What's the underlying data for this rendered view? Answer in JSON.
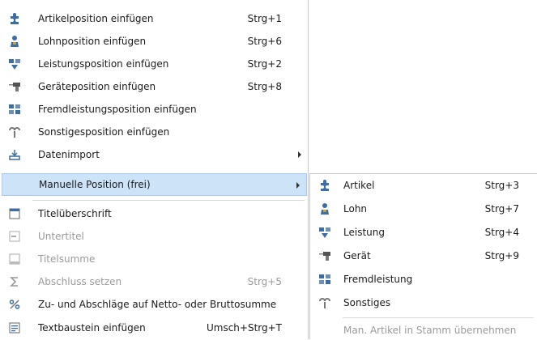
{
  "main_menu": {
    "items": [
      {
        "label": "Artikelposition einfügen",
        "shortcut": "Strg+1",
        "icon": "puzzle-icon"
      },
      {
        "label": "Lohnposition einfügen",
        "shortcut": "Strg+6",
        "icon": "worker-icon"
      },
      {
        "label": "Leistungsposition einfügen",
        "shortcut": "Strg+2",
        "icon": "performance-icon"
      },
      {
        "label": "Geräteposition einfügen",
        "shortcut": "Strg+8",
        "icon": "drill-icon"
      },
      {
        "label": "Fremdleistungsposition einfügen",
        "shortcut": "",
        "icon": "external-service-icon"
      },
      {
        "label": "Sonstigesposition einfügen",
        "shortcut": "",
        "icon": "misc-icon"
      },
      {
        "label": "Datenimport",
        "shortcut": "",
        "icon": "import-icon"
      },
      {
        "label": "Manuelle Position (frei)",
        "shortcut": "",
        "icon": ""
      },
      {
        "label": "Titelüberschrift",
        "shortcut": "",
        "icon": "title-heading-icon"
      },
      {
        "label": "Untertitel",
        "shortcut": "",
        "icon": "subtitle-icon"
      },
      {
        "label": "Titelsumme",
        "shortcut": "",
        "icon": "title-sum-icon"
      },
      {
        "label": "Abschluss setzen",
        "shortcut": "Strg+5",
        "icon": "sigma-icon"
      },
      {
        "label": "Zu- und Abschläge auf Netto- oder Bruttosumme",
        "shortcut": "",
        "icon": "percent-icon"
      },
      {
        "label": "Textbaustein einfügen",
        "shortcut": "Umsch+Strg+T",
        "icon": "text-block-icon"
      }
    ]
  },
  "sub_menu": {
    "items": [
      {
        "label": "Artikel",
        "shortcut": "Strg+3",
        "icon": "puzzle-icon"
      },
      {
        "label": "Lohn",
        "shortcut": "Strg+7",
        "icon": "worker-icon"
      },
      {
        "label": "Leistung",
        "shortcut": "Strg+4",
        "icon": "performance-icon"
      },
      {
        "label": "Gerät",
        "shortcut": "Strg+9",
        "icon": "drill-icon"
      },
      {
        "label": "Fremdleistung",
        "shortcut": "",
        "icon": "external-service-icon"
      },
      {
        "label": "Sonstiges",
        "shortcut": "",
        "icon": "misc-icon"
      },
      {
        "label": "Man. Artikel in Stamm übernehmen",
        "shortcut": "",
        "icon": ""
      }
    ]
  },
  "colors": {
    "highlight": "#cde3f7",
    "icon_blue": "#3a6ea5",
    "disabled": "#9a9a9a"
  }
}
